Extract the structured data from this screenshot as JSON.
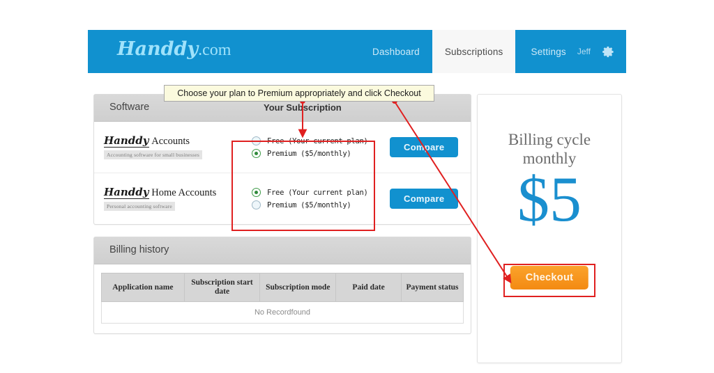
{
  "navbar": {
    "brand_script": "Handdy",
    "brand_suffix": ".com",
    "items": [
      {
        "label": "Dashboard",
        "active": false
      },
      {
        "label": "Subscriptions",
        "active": true
      },
      {
        "label": "Settings",
        "active": false
      }
    ],
    "user": "Jeff",
    "gear_icon": "gear-icon"
  },
  "subscription_panel": {
    "header_software": "Software",
    "header_subscription": "Your Subscription",
    "rows": [
      {
        "logo_script": "Handdy",
        "logo_plain": "Accounts",
        "tagline": "Accounting software for small businesses",
        "options": [
          {
            "label": "Free (Your current plan)",
            "selected": false
          },
          {
            "label": "Premium ($5/monthly)",
            "selected": true
          }
        ],
        "compare_label": "Compare"
      },
      {
        "logo_script": "Handdy",
        "logo_plain": "Home Accounts",
        "tagline": "Personal accounting software",
        "options": [
          {
            "label": "Free (Your current plan)",
            "selected": true
          },
          {
            "label": "Premium ($5/monthly)",
            "selected": false
          }
        ],
        "compare_label": "Compare"
      }
    ]
  },
  "billing_history": {
    "title": "Billing history",
    "columns": [
      "Application name",
      "Subscription start date",
      "Subscription mode",
      "Paid date",
      "Payment status"
    ],
    "empty_message": "No Recordfound"
  },
  "billing_sidebar": {
    "title_line1": "Billing cycle",
    "title_line2": "monthly",
    "price": "$5",
    "checkout_label": "Checkout"
  },
  "annotations": {
    "tooltip": "Choose your plan to Premium appropriately and click Checkout",
    "highlight_color": "#e02020"
  }
}
